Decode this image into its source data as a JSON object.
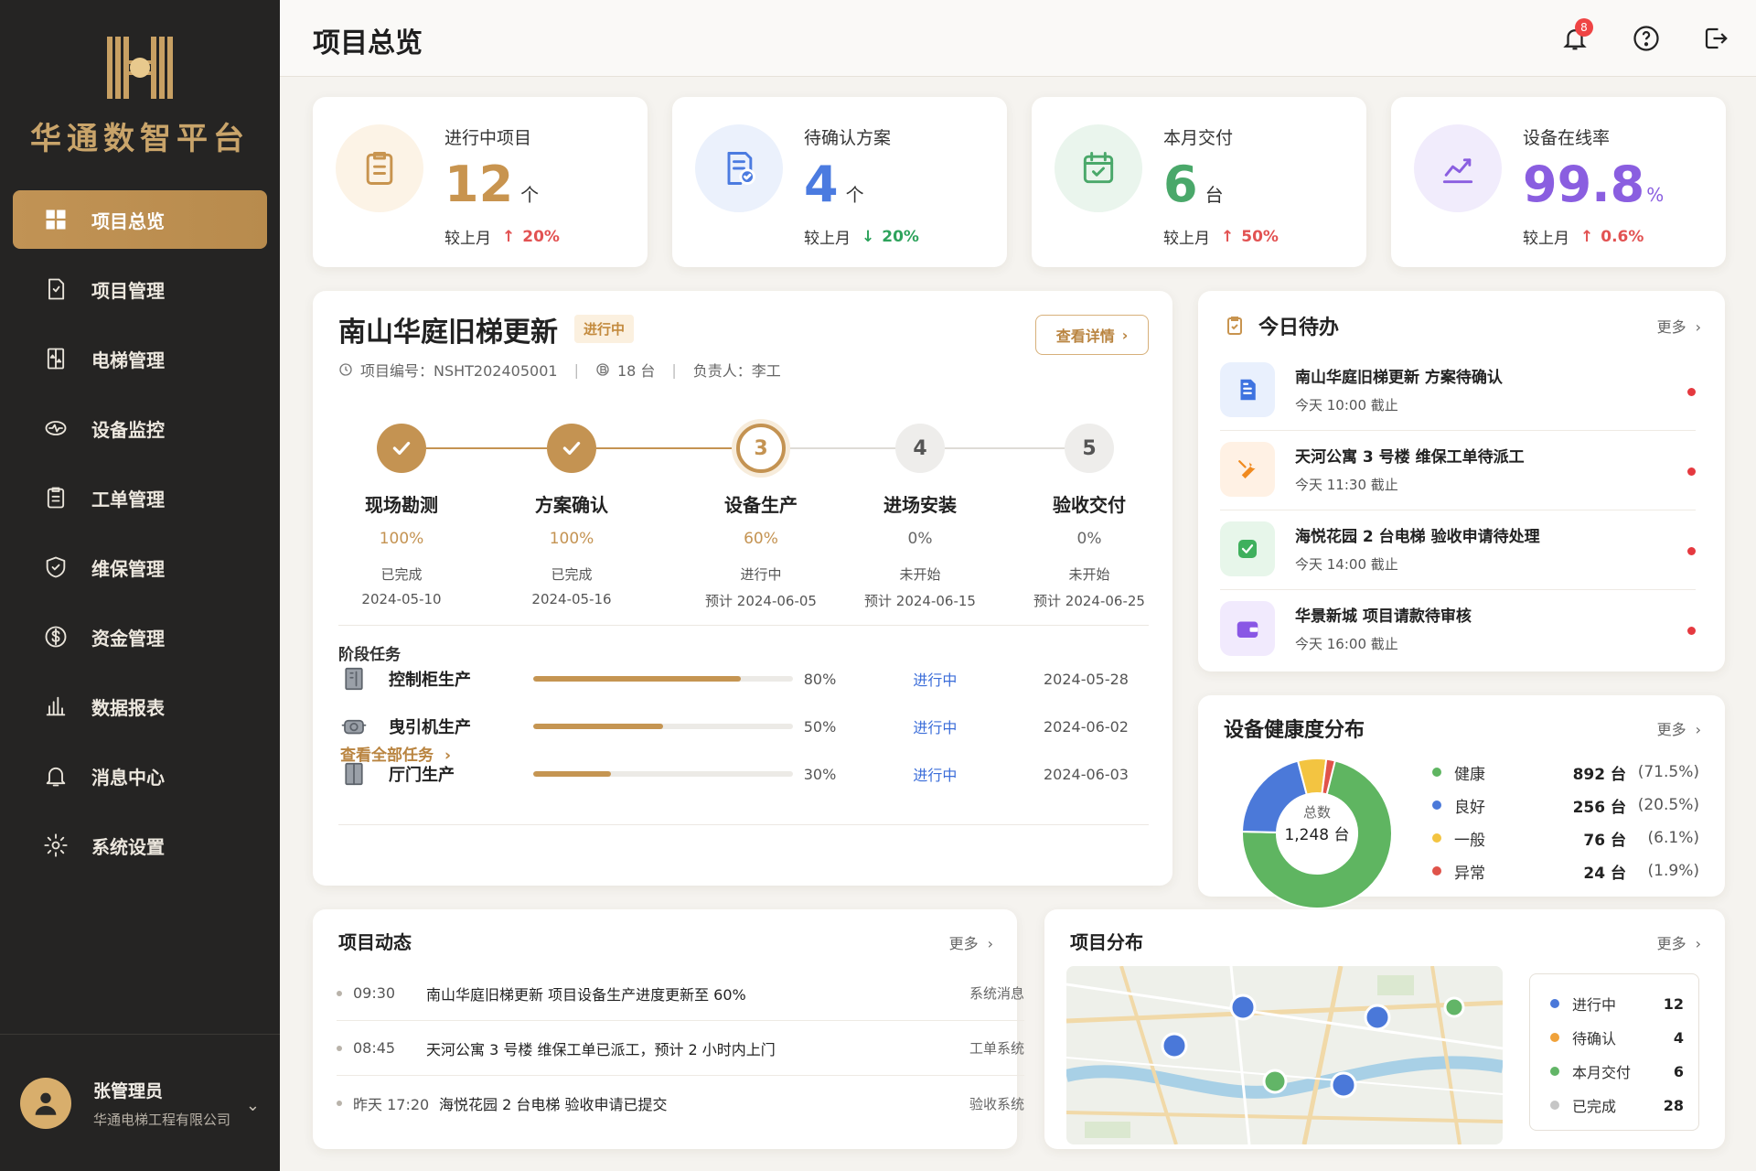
{
  "app": {
    "brand": "华通数智平台"
  },
  "sidebar": {
    "items": [
      {
        "label": "项目总览",
        "icon": "grid-icon",
        "active": true
      },
      {
        "label": "项目管理",
        "icon": "project-file-icon"
      },
      {
        "label": "电梯管理",
        "icon": "elevator-icon"
      },
      {
        "label": "设备监控",
        "icon": "monitor-icon"
      },
      {
        "label": "工单管理",
        "icon": "clipboard-icon"
      },
      {
        "label": "维保管理",
        "icon": "shield-icon"
      },
      {
        "label": "资金管理",
        "icon": "dollar-icon"
      },
      {
        "label": "数据报表",
        "icon": "bar-chart-icon"
      },
      {
        "label": "消息中心",
        "icon": "bell-icon"
      },
      {
        "label": "系统设置",
        "icon": "gear-icon"
      }
    ],
    "user": {
      "name": "张管理员",
      "company": "华通电梯工程有限公司"
    }
  },
  "header": {
    "title": "项目总览",
    "notification_count": "8"
  },
  "stats": [
    {
      "label": "进行中项目",
      "value": "12",
      "unit": "个",
      "compare_label": "较上月",
      "trend": "up",
      "change": "20%",
      "color": "#c8944f",
      "icon": "clipboard-icon"
    },
    {
      "label": "待确认方案",
      "value": "4",
      "unit": "个",
      "compare_label": "较上月",
      "trend": "down",
      "change": "20%",
      "color": "#4b7be0",
      "icon": "document-check-icon"
    },
    {
      "label": "本月交付",
      "value": "6",
      "unit": "台",
      "compare_label": "较上月",
      "trend": "up",
      "change": "50%",
      "color": "#4aa86a",
      "icon": "calendar-check-icon"
    },
    {
      "label": "设备在线率",
      "value": "99.8",
      "unit": "%",
      "compare_label": "较上月",
      "trend": "up",
      "change": "0.6%",
      "color": "#8a5ee0",
      "icon": "trend-chart-icon"
    }
  ],
  "project": {
    "title": "南山华庭旧梯更新",
    "status": "进行中",
    "detail_button": "查看详情",
    "meta": {
      "code": "项目编号：NSHT202405001",
      "units": "18 台",
      "owner": "负责人：李工"
    },
    "steps": [
      {
        "no": "1",
        "name": "现场勘测",
        "pct": "100%",
        "state": "已完成",
        "date": "2024-05-10",
        "status": "done"
      },
      {
        "no": "2",
        "name": "方案确认",
        "pct": "100%",
        "state": "已完成",
        "date": "2024-05-16",
        "status": "done"
      },
      {
        "no": "3",
        "name": "设备生产",
        "pct": "60%",
        "state": "进行中",
        "date": "预计 2024-06-05",
        "status": "current"
      },
      {
        "no": "4",
        "name": "进场安装",
        "pct": "0%",
        "state": "未开始",
        "date": "预计 2024-06-15",
        "status": "todo"
      },
      {
        "no": "5",
        "name": "验收交付",
        "pct": "0%",
        "state": "未开始",
        "date": "预计 2024-06-25",
        "status": "todo"
      }
    ],
    "tasks_title": "阶段任务",
    "tasks": [
      {
        "name": "控制柜生产",
        "progress": 80,
        "pct": "80%",
        "status": "进行中",
        "date": "2024-05-28"
      },
      {
        "name": "曳引机生产",
        "progress": 50,
        "pct": "50%",
        "status": "进行中",
        "date": "2024-06-02"
      },
      {
        "name": "厅门生产",
        "progress": 30,
        "pct": "30%",
        "status": "进行中",
        "date": "2024-06-03"
      }
    ],
    "view_all": "查看全部任务"
  },
  "todo": {
    "title": "今日待办",
    "more": "更多",
    "items": [
      {
        "title": "南山华庭旧梯更新 方案待确认",
        "time": "今天 10:00 截止",
        "icon": "document-icon",
        "color": "#3e73e0",
        "bg": "#e9f0fd"
      },
      {
        "title": "天河公寓 3 号楼 维保工单待派工",
        "time": "今天 11:30 截止",
        "icon": "wrench-icon",
        "color": "#f08a1f",
        "bg": "#fff1e4"
      },
      {
        "title": "海悦花园 2 台电梯 验收申请待处理",
        "time": "今天 14:00 截止",
        "icon": "check-icon",
        "color": "#3fb05d",
        "bg": "#e7f6ea"
      },
      {
        "title": "华景新城 项目请款待审核",
        "time": "今天 16:00 截止",
        "icon": "wallet-icon",
        "color": "#8957e5",
        "bg": "#f1eafd"
      }
    ]
  },
  "health": {
    "title": "设备健康度分布",
    "more": "更多",
    "total_label": "总数",
    "total": "1,248 台",
    "items": [
      {
        "name": "健康",
        "count": "892 台",
        "pct": "(71.5%)",
        "value": 71.5,
        "color": "#5fb561"
      },
      {
        "name": "良好",
        "count": "256 台",
        "pct": "(20.5%)",
        "value": 20.5,
        "color": "#4b79d9"
      },
      {
        "name": "一般",
        "count": "76 台",
        "pct": "(6.1%)",
        "value": 6.1,
        "color": "#f3c441"
      },
      {
        "name": "异常",
        "count": "24 台",
        "pct": "(1.9%)",
        "value": 1.9,
        "color": "#e0534a"
      }
    ]
  },
  "feed": {
    "title": "项目动态",
    "more": "更多",
    "items": [
      {
        "time": "09:30",
        "text": "南山华庭旧梯更新 项目设备生产进度更新至 60%",
        "source": "系统消息"
      },
      {
        "time": "08:45",
        "text": "天河公寓 3 号楼 维保工单已派工，预计 2 小时内上门",
        "source": "工单系统"
      },
      {
        "time": "昨天 17:20",
        "text": "海悦花园 2 台电梯 验收申请已提交",
        "source": "验收系统"
      }
    ]
  },
  "distribution": {
    "title": "项目分布",
    "more": "更多",
    "legend": [
      {
        "name": "进行中",
        "count": "12",
        "color": "#4a78d9"
      },
      {
        "name": "待确认",
        "count": "4",
        "color": "#f0a23a"
      },
      {
        "name": "本月交付",
        "count": "6",
        "color": "#62b567"
      },
      {
        "name": "已完成",
        "count": "28",
        "color": "#c6c6c6"
      }
    ]
  }
}
